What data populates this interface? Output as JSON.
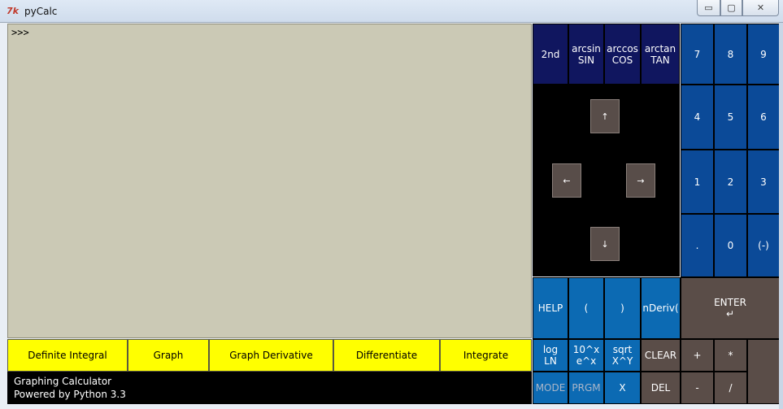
{
  "window": {
    "title": "pyCalc",
    "icon_glyph": "7k"
  },
  "window_controls": {
    "minimize": "▭",
    "maximize": "▢",
    "close": "✕"
  },
  "display": {
    "prompt": ">>>"
  },
  "function_buttons": [
    "Definite Integral",
    "Graph",
    "Graph Derivative",
    "Differentiate",
    "Integrate"
  ],
  "info": {
    "line1": "Graphing Calculator",
    "line2": "Powered by Python 3.3"
  },
  "keys": {
    "second": "2nd",
    "sin": {
      "top": "arcsin",
      "bottom": "SIN"
    },
    "cos": {
      "top": "arccos",
      "bottom": "COS"
    },
    "tan": {
      "top": "arctan",
      "bottom": "TAN"
    },
    "d7": "7",
    "d8": "8",
    "d9": "9",
    "d4": "4",
    "d5": "5",
    "d6": "6",
    "d1": "1",
    "d2": "2",
    "d3": "3",
    "dot": ".",
    "d0": "0",
    "neg": "(-)",
    "up": "↑",
    "left": "←",
    "right": "→",
    "down": "↓",
    "help": "HELP",
    "lparen": "(",
    "rparen": ")",
    "nderiv": "nDeriv(",
    "enter": {
      "label": "ENTER",
      "glyph": "↵"
    },
    "ln": {
      "top": "log",
      "bottom": "LN"
    },
    "exp": {
      "top": "10^x",
      "bottom": "e^x"
    },
    "sqrt": {
      "top": "sqrt",
      "bottom": "X^Y"
    },
    "clear": "CLEAR",
    "plus": "+",
    "times": "*",
    "mode": "MODE",
    "prgm": "PRGM",
    "x": "X",
    "del": "DEL",
    "minus": "-",
    "divide": "/"
  },
  "colors": {
    "display_bg": "#cbc9b5",
    "function_bg": "#ffff00",
    "navy": "#10165f",
    "blue": "#0b4a98",
    "light_blue": "#0c6ab3",
    "gray": "#5a4d48"
  }
}
